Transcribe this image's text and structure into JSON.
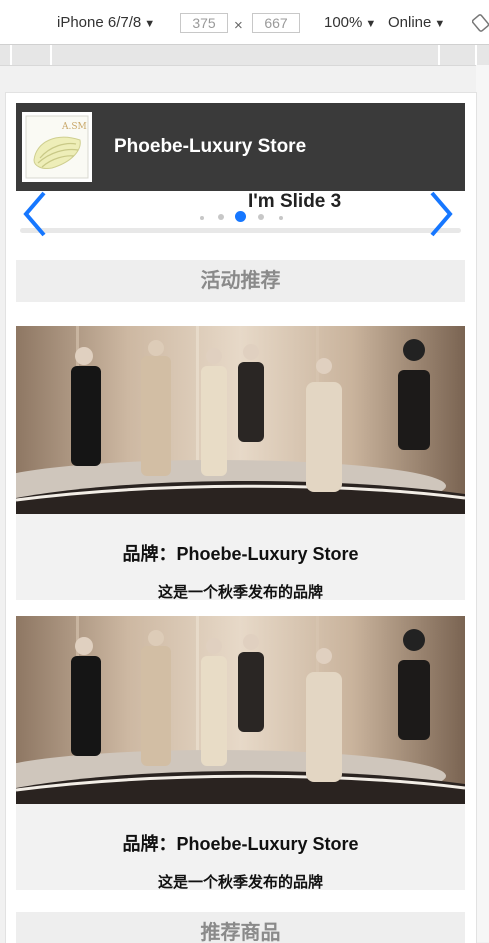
{
  "devtools": {
    "device": "iPhone 6/7/8",
    "width": "375",
    "times": "×",
    "height": "667",
    "zoom": "100%",
    "network": "Online"
  },
  "header": {
    "store_name": "Phoebe-Luxury Store",
    "logo_text": "A.SM"
  },
  "swiper": {
    "slide_title": "I'm Slide 3",
    "active_index": 2,
    "dot_count": 5
  },
  "sections": {
    "activity_title": "活动推荐",
    "recommend_title": "推荐商品"
  },
  "cards": [
    {
      "brand": "品牌：Phoebe-Luxury Store",
      "desc": "这是一个秋季发布的品牌"
    },
    {
      "brand": "品牌：Phoebe-Luxury Store",
      "desc": "这是一个秋季发布的品牌"
    }
  ],
  "colors": {
    "accent": "#1677ff",
    "header_bg": "#3a3a3a",
    "section_bg": "#eeeeee"
  }
}
